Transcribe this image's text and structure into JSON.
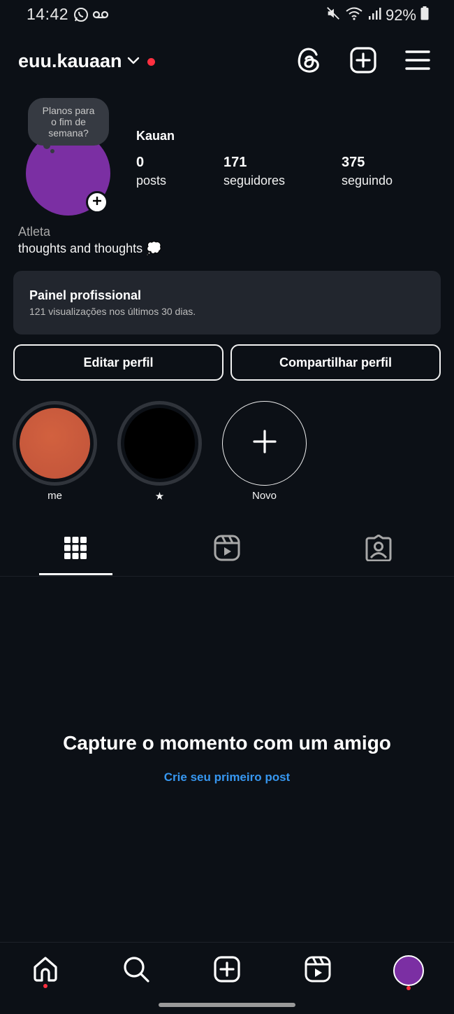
{
  "status_bar": {
    "time": "14:42",
    "battery": "92%",
    "icons": [
      "whatsapp-icon",
      "voicemail-icon",
      "mute-icon",
      "wifi-icon",
      "signal-icon",
      "battery-icon"
    ]
  },
  "header": {
    "username": "euu.kauaan",
    "icons": [
      "chevron-down-icon",
      "threads-icon",
      "create-post-icon",
      "menu-icon"
    ],
    "accent_dot_color": "#ff3040"
  },
  "profile": {
    "note": "Planos para o fim de semana?",
    "display_name": "Kauan",
    "stats": [
      {
        "count": "0",
        "label": "posts"
      },
      {
        "count": "171",
        "label": "seguidores"
      },
      {
        "count": "375",
        "label": "seguindo"
      }
    ],
    "category": "Atleta",
    "bio": "thoughts and thoughts 💭",
    "avatar_color": "#7b2fa3"
  },
  "pro_panel": {
    "title": "Painel profissional",
    "subtitle": "121 visualizações nos últimos 30 dias."
  },
  "actions": {
    "edit": "Editar perfil",
    "share": "Compartilhar perfil"
  },
  "highlights": [
    {
      "label": "me",
      "color": "#c9573a"
    },
    {
      "label": "★",
      "color": "#000000"
    },
    {
      "label": "Novo"
    }
  ],
  "tabs": [
    "grid-icon",
    "reels-icon",
    "tagged-icon"
  ],
  "empty_state": {
    "title": "Capture o momento com um amigo",
    "link": "Crie seu primeiro post",
    "link_color": "#3797f0"
  },
  "bottom_nav": [
    "home-icon",
    "search-icon",
    "create-icon",
    "reels-icon",
    "profile-avatar"
  ]
}
